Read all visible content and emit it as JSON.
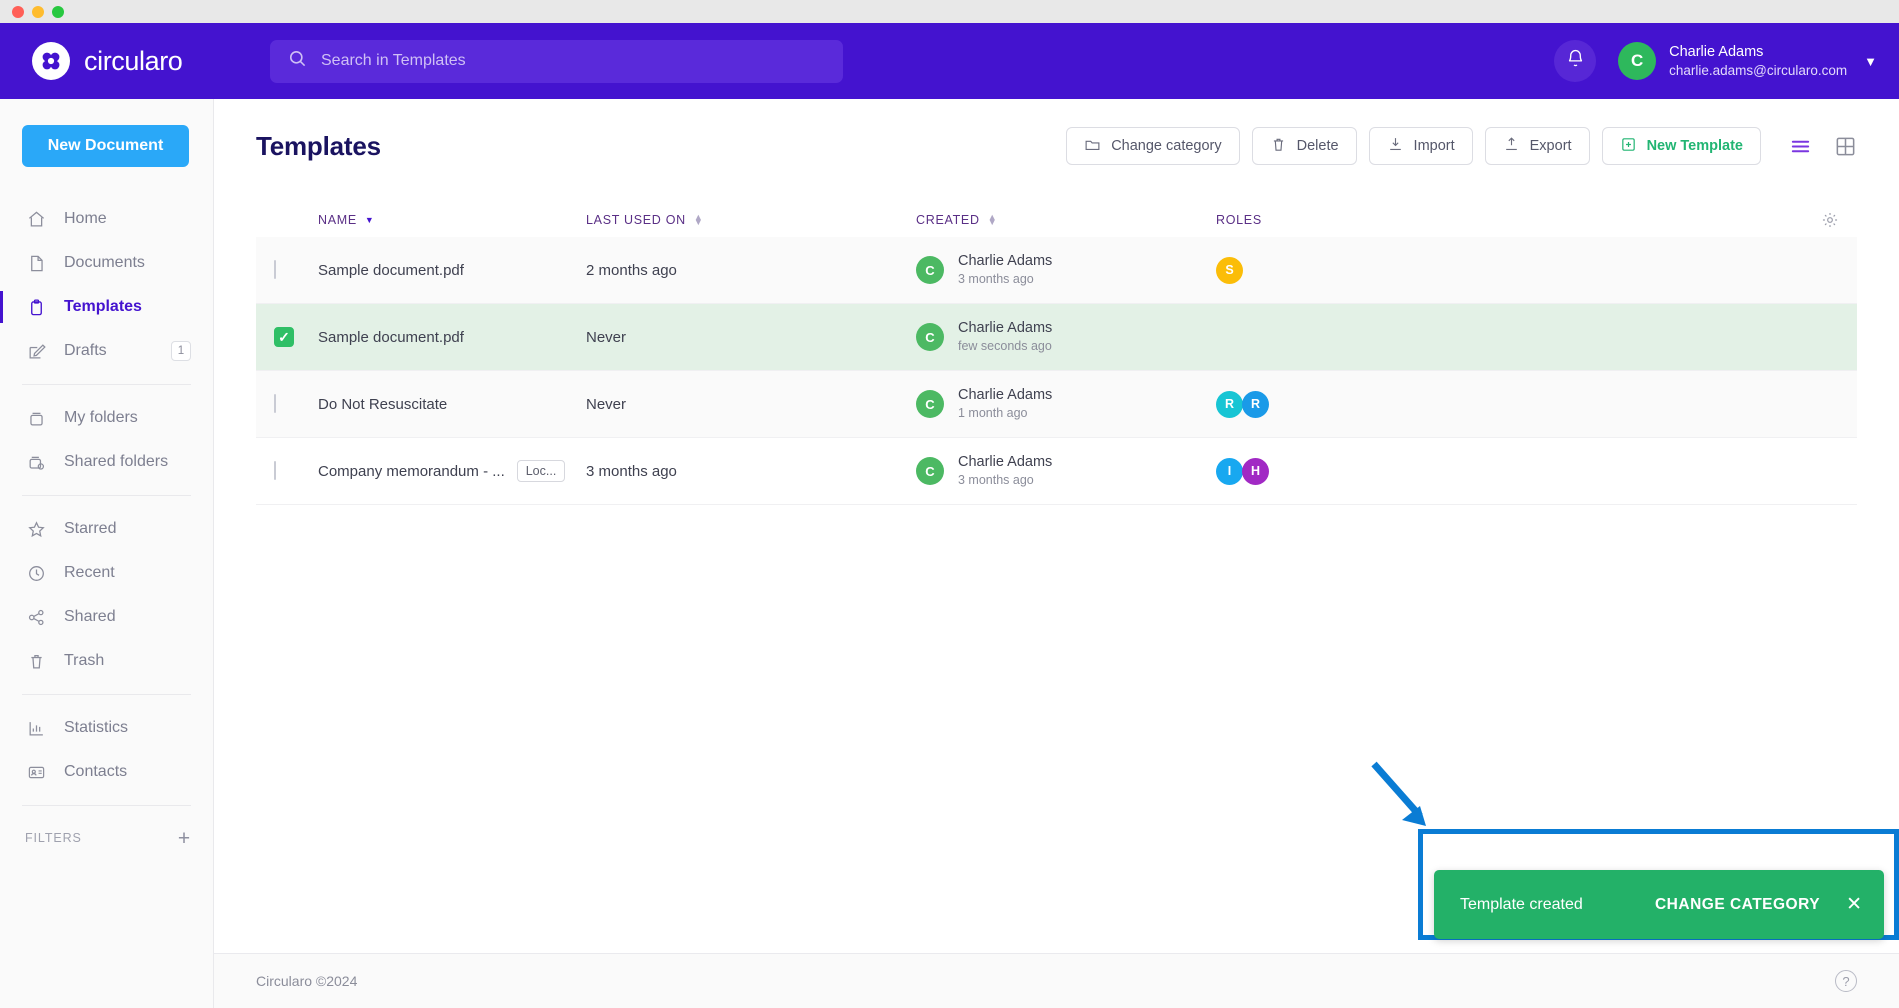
{
  "window": {
    "traffic_lights": [
      "close",
      "minimize",
      "maximize"
    ]
  },
  "header": {
    "brand_name": "circularo",
    "search_placeholder": "Search in Templates",
    "search_value": "",
    "notifications_icon": "bell-icon",
    "user": {
      "initial": "C",
      "name": "Charlie Adams",
      "email": "charlie.adams@circularo.com",
      "avatar_color": "#2eb85c"
    }
  },
  "sidebar": {
    "new_document_label": "New Document",
    "groups": [
      {
        "items": [
          {
            "label": "Home",
            "icon": "home-icon",
            "active": false,
            "badge": ""
          },
          {
            "label": "Documents",
            "icon": "document-icon",
            "active": false,
            "badge": ""
          },
          {
            "label": "Templates",
            "icon": "clipboard-icon",
            "active": true,
            "badge": ""
          },
          {
            "label": "Drafts",
            "icon": "pencil-square-icon",
            "active": false,
            "badge": "1"
          }
        ]
      },
      {
        "items": [
          {
            "label": "My folders",
            "icon": "folder-icon",
            "active": false,
            "badge": ""
          },
          {
            "label": "Shared folders",
            "icon": "shared-folder-icon",
            "active": false,
            "badge": ""
          }
        ]
      },
      {
        "items": [
          {
            "label": "Starred",
            "icon": "star-icon",
            "active": false,
            "badge": ""
          },
          {
            "label": "Recent",
            "icon": "clock-icon",
            "active": false,
            "badge": ""
          },
          {
            "label": "Shared",
            "icon": "share-icon",
            "active": false,
            "badge": ""
          },
          {
            "label": "Trash",
            "icon": "trash-icon",
            "active": false,
            "badge": ""
          }
        ]
      },
      {
        "items": [
          {
            "label": "Statistics",
            "icon": "bar-chart-icon",
            "active": false,
            "badge": ""
          },
          {
            "label": "Contacts",
            "icon": "contact-card-icon",
            "active": false,
            "badge": ""
          }
        ]
      }
    ],
    "filters_label": "FILTERS",
    "filters_add": "+"
  },
  "main": {
    "page_title": "Templates",
    "toolbar": {
      "change_category": "Change category",
      "delete": "Delete",
      "import": "Import",
      "export": "Export",
      "new_template": "New Template",
      "list_view_icon": "list-view-icon",
      "grid_view_icon": "grid-view-icon",
      "active_view": "list"
    },
    "table": {
      "headers": {
        "name": "NAME",
        "last_used_on": "LAST USED ON",
        "created": "CREATED",
        "roles": "ROLES"
      },
      "sort_column": "NAME",
      "sort_direction": "desc",
      "settings_icon": "gear-icon",
      "rows": [
        {
          "selected": false,
          "name": "Sample document.pdf",
          "tag": "",
          "last_used_on": "2 months ago",
          "creator_initial": "C",
          "creator_name": "Charlie Adams",
          "created_when": "3 months ago",
          "roles": [
            {
              "initial": "S",
              "color": "#fbbd08"
            }
          ]
        },
        {
          "selected": true,
          "name": "Sample document.pdf",
          "tag": "",
          "last_used_on": "Never",
          "creator_initial": "C",
          "creator_name": "Charlie Adams",
          "created_when": "few seconds ago",
          "roles": []
        },
        {
          "selected": false,
          "name": "Do Not Resuscitate",
          "tag": "",
          "last_used_on": "Never",
          "creator_initial": "C",
          "creator_name": "Charlie Adams",
          "created_when": "1 month ago",
          "roles": [
            {
              "initial": "R",
              "color": "#17c5d4"
            },
            {
              "initial": "R",
              "color": "#1a9ae8"
            }
          ]
        },
        {
          "selected": false,
          "name": "Company memorandum - ...",
          "tag": "Loc...",
          "last_used_on": "3 months ago",
          "creator_initial": "C",
          "creator_name": "Charlie Adams",
          "created_when": "3 months ago",
          "roles": [
            {
              "initial": "I",
              "color": "#18a8f0"
            },
            {
              "initial": "H",
              "color": "#a129c4"
            }
          ]
        }
      ]
    }
  },
  "toast": {
    "message": "Template created",
    "action_label": "CHANGE CATEGORY",
    "close_icon": "close-icon",
    "background": "#23b168"
  },
  "annotation": {
    "arrow_color": "#0a7cd4",
    "box_color": "#0a7cd4"
  },
  "footer": {
    "copyright": "Circularo ©2024",
    "help_icon": "help-icon",
    "help_glyph": "?"
  }
}
